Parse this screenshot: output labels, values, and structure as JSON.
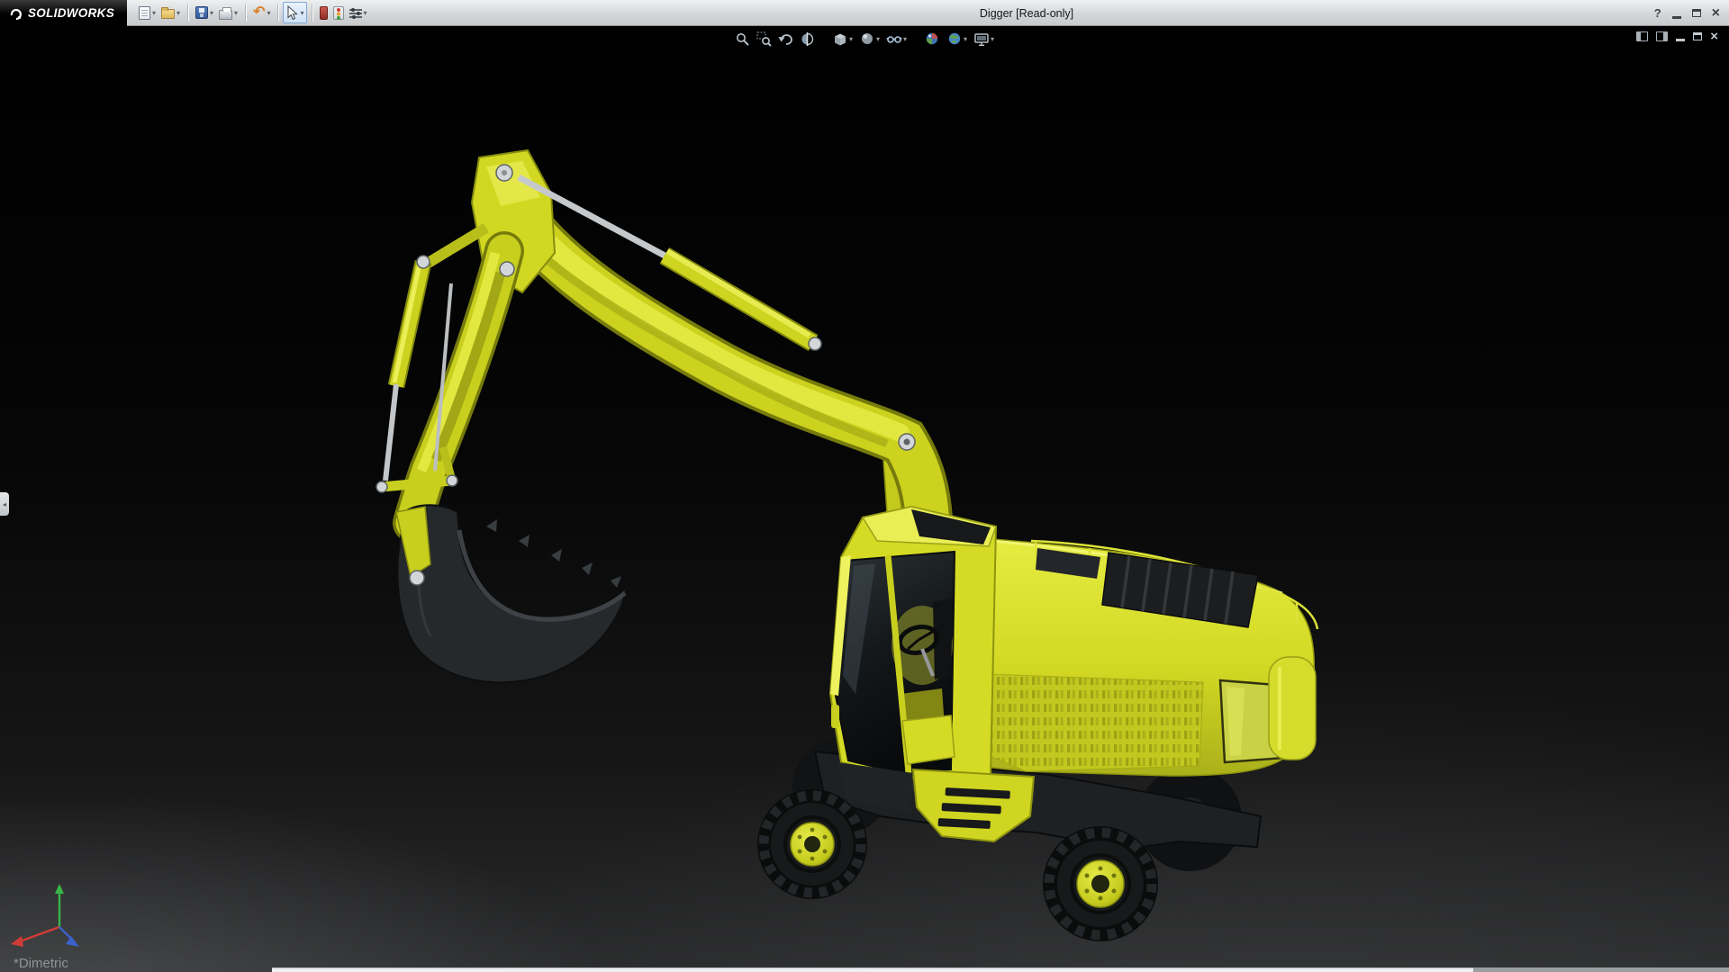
{
  "titlebar": {
    "brand": "SOLIDWORKS",
    "title": "Digger [Read-only]",
    "help_label": "?",
    "toolbar_items": [
      {
        "name": "new-document",
        "has_dropdown": true
      },
      {
        "name": "open",
        "has_dropdown": true
      },
      {
        "name": "save",
        "has_dropdown": true
      },
      {
        "name": "print",
        "has_dropdown": true
      },
      {
        "name": "undo",
        "glyph": "↶",
        "has_dropdown": true
      },
      {
        "name": "select",
        "has_dropdown": true,
        "active": true
      },
      {
        "name": "solidworks-xpert",
        "has_dropdown": false
      },
      {
        "name": "rebuild",
        "has_dropdown": false
      },
      {
        "name": "options",
        "has_dropdown": true
      }
    ]
  },
  "ui": {
    "dropdown_glyph": "▾",
    "close_glyph": "×",
    "collapse_glyph": "◂"
  },
  "hud_toolbar": {
    "icons": [
      "zoom-to-fit-icon",
      "zoom-to-area-icon",
      "previous-view-icon",
      "section-view-icon",
      "view-orientation-icon",
      "display-style-icon",
      "hide-show-items-icon",
      "edit-appearance-icon",
      "apply-scene-icon",
      "view-settings-icon"
    ]
  },
  "document_window": {
    "controls": [
      "left-pane-icon",
      "right-pane-icon",
      "minimize",
      "restore",
      "close"
    ]
  },
  "viewport": {
    "orientation_label": "*Dimetric",
    "model_name": "Digger",
    "colors": {
      "model_yellow": "#d5db24",
      "model_dark_parts": "#26292b",
      "pin_silver": "#d3d6d8",
      "background_top": "#000000",
      "background_bottom": "#2a2b2c"
    }
  }
}
